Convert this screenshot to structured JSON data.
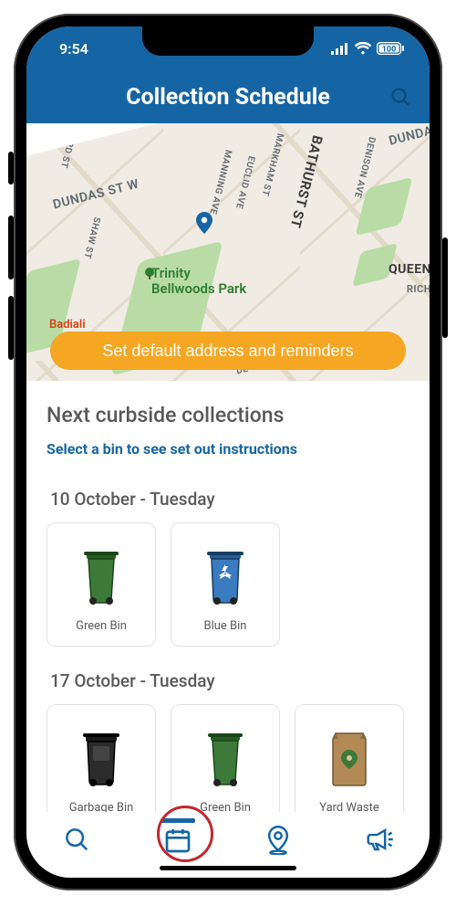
{
  "status": {
    "time": "9:54",
    "battery": "100"
  },
  "header": {
    "title": "Collection Schedule"
  },
  "map": {
    "cta_label": "Set default address and reminders",
    "park_name": "Trinity\nBellwoods Park",
    "poi": "Badiali",
    "roads": {
      "dundas_w": "DUNDAS ST W",
      "dundas": "DUNDA",
      "bathurst": "BATHURST ST",
      "markham": "MARKHAM ST",
      "manning": "MANNING AVE",
      "euclid": "EUCLID AVE",
      "denison": "DENISON AVE",
      "shaw": "SHAW ST",
      "ford": "FORD ST",
      "side": "DE ST",
      "queen": "QUEEN",
      "rich": "RICH"
    }
  },
  "content": {
    "heading": "Next curbside collections",
    "hint": "Select a bin to see set out instructions",
    "days": [
      {
        "date": "10 October - Tuesday",
        "bins": [
          {
            "label": "Green Bin",
            "icon": "green-bin"
          },
          {
            "label": "Blue Bin",
            "icon": "blue-bin"
          }
        ]
      },
      {
        "date": "17 October - Tuesday",
        "bins": [
          {
            "label": "Garbage Bin",
            "icon": "garbage-bin"
          },
          {
            "label": "Green Bin",
            "icon": "green-bin"
          },
          {
            "label": "Yard Waste",
            "icon": "yard-waste"
          }
        ]
      }
    ]
  },
  "nav": {
    "items": [
      "search",
      "schedule",
      "location",
      "announce"
    ],
    "active": "schedule"
  },
  "colors": {
    "brand": "#1565a5",
    "accent": "#f5a623",
    "green_bin": "#3d7a3a",
    "blue_bin": "#3b7bbf",
    "garbage_bin": "#2b2b2b",
    "yard_bag": "#b38a56"
  }
}
